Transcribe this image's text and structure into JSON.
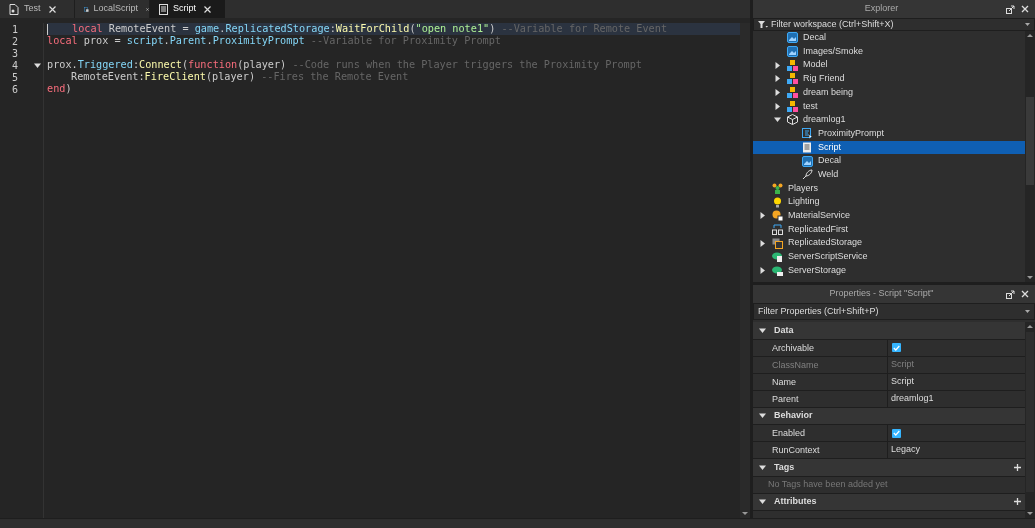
{
  "tabs": [
    {
      "label": "Test",
      "kind": "test",
      "selected": false
    },
    {
      "label": "LocalScript",
      "kind": "localscript",
      "selected": false
    },
    {
      "label": "Script",
      "kind": "script",
      "selected": true
    }
  ],
  "editor": {
    "lines": [
      {
        "number": "1",
        "current": true,
        "fold": false,
        "indent": true,
        "tokens": [
          {
            "kind": "keyword",
            "text": "local"
          },
          {
            "kind": "plain",
            "text": " RemoteEvent = "
          },
          {
            "kind": "global",
            "text": "game"
          },
          {
            "kind": "plain",
            "text": "."
          },
          {
            "kind": "global",
            "text": "ReplicatedStorage"
          },
          {
            "kind": "plain",
            "text": ":"
          },
          {
            "kind": "method",
            "text": "WaitForChild"
          },
          {
            "kind": "plain",
            "text": "("
          },
          {
            "kind": "string",
            "text": "\"open note1\""
          },
          {
            "kind": "plain",
            "text": ")"
          },
          {
            "kind": "comment",
            "text": "--Variable for Remote Event"
          }
        ]
      },
      {
        "number": "2",
        "current": false,
        "fold": false,
        "indent": false,
        "tokens": [
          {
            "kind": "keyword",
            "text": "local"
          },
          {
            "kind": "plain",
            "text": " prox = "
          },
          {
            "kind": "global",
            "text": "script"
          },
          {
            "kind": "plain",
            "text": "."
          },
          {
            "kind": "global",
            "text": "Parent"
          },
          {
            "kind": "plain",
            "text": "."
          },
          {
            "kind": "global",
            "text": "ProximityPrompt"
          },
          {
            "kind": "comment",
            "text": "--Variable for Proximity Prompt"
          }
        ]
      },
      {
        "number": "3",
        "current": false,
        "fold": false
      },
      {
        "number": "4",
        "current": false,
        "fold": true,
        "indent": false,
        "tokens": [
          {
            "kind": "plain",
            "text": "prox."
          },
          {
            "kind": "global",
            "text": "Triggered"
          },
          {
            "kind": "plain",
            "text": ":"
          },
          {
            "kind": "method",
            "text": "Connect"
          },
          {
            "kind": "plain",
            "text": "("
          },
          {
            "kind": "keyword",
            "text": "function"
          },
          {
            "kind": "plain",
            "text": "(player)"
          },
          {
            "kind": "comment",
            "text": "--Code runs when the Player triggers the Proximity Prompt"
          }
        ]
      },
      {
        "number": "5",
        "current": false,
        "fold": false,
        "indent": true,
        "tokens": [
          {
            "kind": "plain",
            "text": "RemoteEvent:"
          },
          {
            "kind": "method",
            "text": "FireClient"
          },
          {
            "kind": "plain",
            "text": "(player)"
          },
          {
            "kind": "comment",
            "text": "--Fires the Remote Event"
          }
        ]
      },
      {
        "number": "6",
        "current": false,
        "fold": false,
        "indent": false,
        "tokens": [
          {
            "kind": "keyword",
            "text": "end"
          },
          {
            "kind": "plain",
            "text": ")"
          }
        ]
      }
    ]
  },
  "explorer": {
    "title": "Explorer",
    "filter": {
      "placeholder": "Filter workspace (Ctrl+Shift+X)"
    },
    "workspace_children": [
      {
        "name": "Decal",
        "kind": "decal",
        "selected": false
      },
      {
        "name": "Images/Smoke",
        "kind": "decal",
        "selected": false
      },
      {
        "name": "Model",
        "kind": "model",
        "expanded": false,
        "selected": false
      },
      {
        "name": "Rig Friend",
        "kind": "model",
        "expanded": false,
        "selected": false
      },
      {
        "name": "dream being",
        "kind": "model",
        "expanded": false,
        "selected": false
      },
      {
        "name": "test",
        "kind": "model",
        "expanded": false,
        "selected": false
      },
      {
        "name": "dreamlog1",
        "kind": "part",
        "expanded": true,
        "selected": false,
        "children": [
          {
            "name": "ProximityPrompt",
            "kind": "prompt",
            "selected": false
          },
          {
            "name": "Script",
            "kind": "script",
            "selected": true
          },
          {
            "name": "Decal",
            "kind": "decal",
            "selected": false
          },
          {
            "name": "Weld",
            "kind": "weld",
            "selected": false
          }
        ]
      }
    ],
    "services": [
      {
        "name": "Players",
        "kind": "players",
        "selected": false
      },
      {
        "name": "Lighting",
        "kind": "lighting",
        "selected": false
      },
      {
        "name": "MaterialService",
        "kind": "material",
        "expanded": false,
        "selected": false
      },
      {
        "name": "ReplicatedFirst",
        "kind": "replicatedfirst",
        "selected": false
      },
      {
        "name": "ReplicatedStorage",
        "kind": "replicatedstorage",
        "expanded": false,
        "selected": false
      },
      {
        "name": "ServerScriptService",
        "kind": "serverscript",
        "selected": false
      },
      {
        "name": "ServerStorage",
        "kind": "serverstorage",
        "expanded": false,
        "selected": false
      }
    ]
  },
  "properties": {
    "title": "Properties - Script \"Script\"",
    "filter": {
      "placeholder": "Filter Properties (Ctrl+Shift+P)"
    },
    "sections": [
      {
        "name": "Data",
        "expanded": true,
        "addable": false,
        "rows": [
          {
            "kind": "checkbox",
            "name": "Archivable",
            "checked": true,
            "disabled": false
          },
          {
            "kind": "text",
            "name": "ClassName",
            "value": "Script",
            "disabled": true
          },
          {
            "kind": "text",
            "name": "Name",
            "value": "Script",
            "disabled": false
          },
          {
            "kind": "text",
            "name": "Parent",
            "value": "dreamlog1",
            "disabled": false
          }
        ]
      },
      {
        "name": "Behavior",
        "expanded": true,
        "addable": false,
        "rows": [
          {
            "kind": "checkbox",
            "name": "Enabled",
            "checked": true,
            "disabled": false
          },
          {
            "kind": "text",
            "name": "RunContext",
            "value": "Legacy",
            "disabled": false
          }
        ]
      },
      {
        "name": "Tags",
        "expanded": true,
        "addable": true,
        "empty": "No Tags have been added yet"
      },
      {
        "name": "Attributes",
        "expanded": true,
        "addable": true
      }
    ]
  }
}
